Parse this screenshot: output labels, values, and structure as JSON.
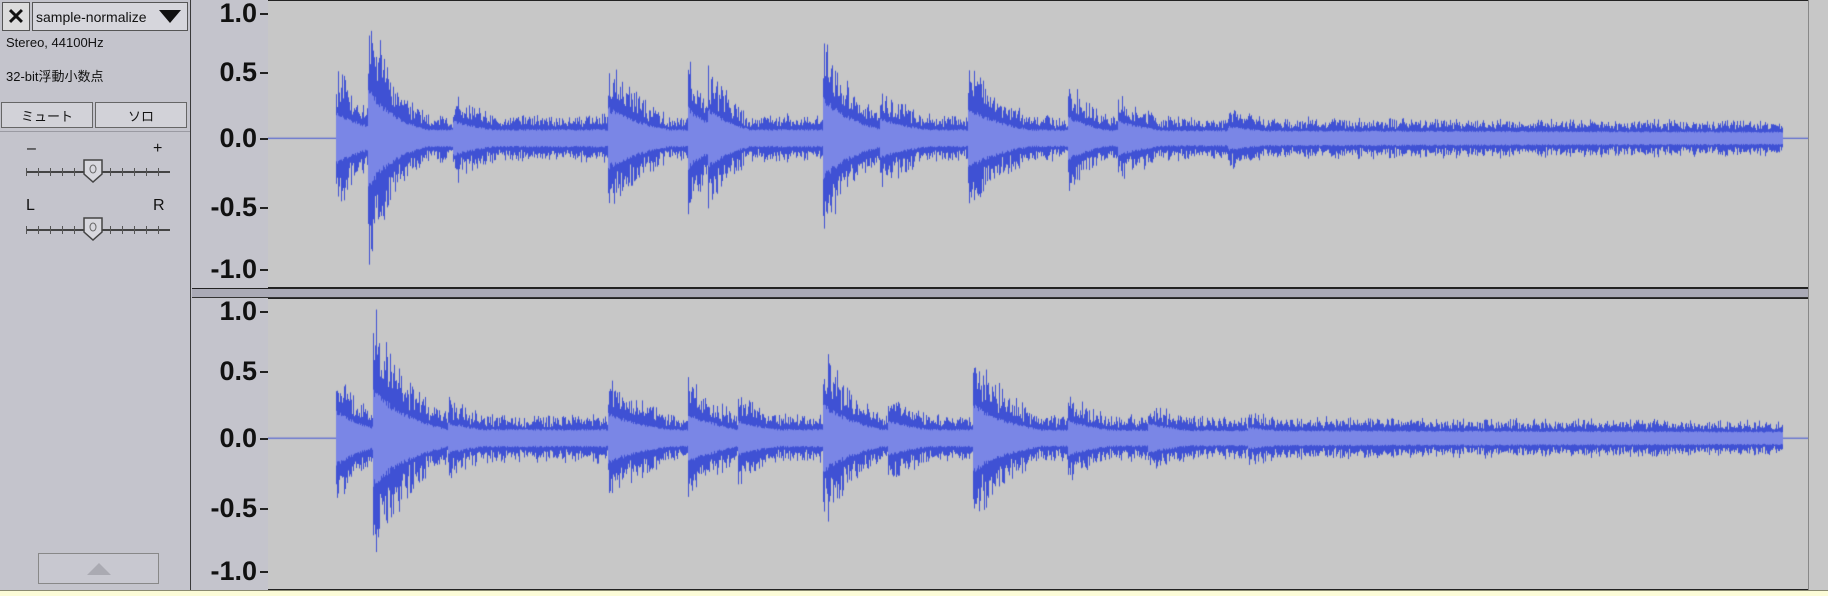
{
  "track": {
    "close_glyph": "✕",
    "name": "sample-normalize",
    "format_line": "Stereo, 44100Hz",
    "sample_format": "32-bit浮動小数点",
    "mute_label": "ミュート",
    "solo_label": "ソロ",
    "gain": {
      "minus": "–",
      "plus": "+",
      "value": 0
    },
    "pan": {
      "left": "L",
      "right": "R",
      "value": 0
    }
  },
  "ruler": {
    "ticks": [
      "1.0",
      "0.5",
      "0.0",
      "-0.5",
      "-1.0"
    ]
  },
  "channels": [
    {
      "name": "left"
    },
    {
      "name": "right"
    }
  ],
  "colors": {
    "wave_peak": "#3f51d4",
    "wave_rms": "#7a86e6",
    "background": "#c7c7c7",
    "panel": "#c4c4cc"
  }
}
